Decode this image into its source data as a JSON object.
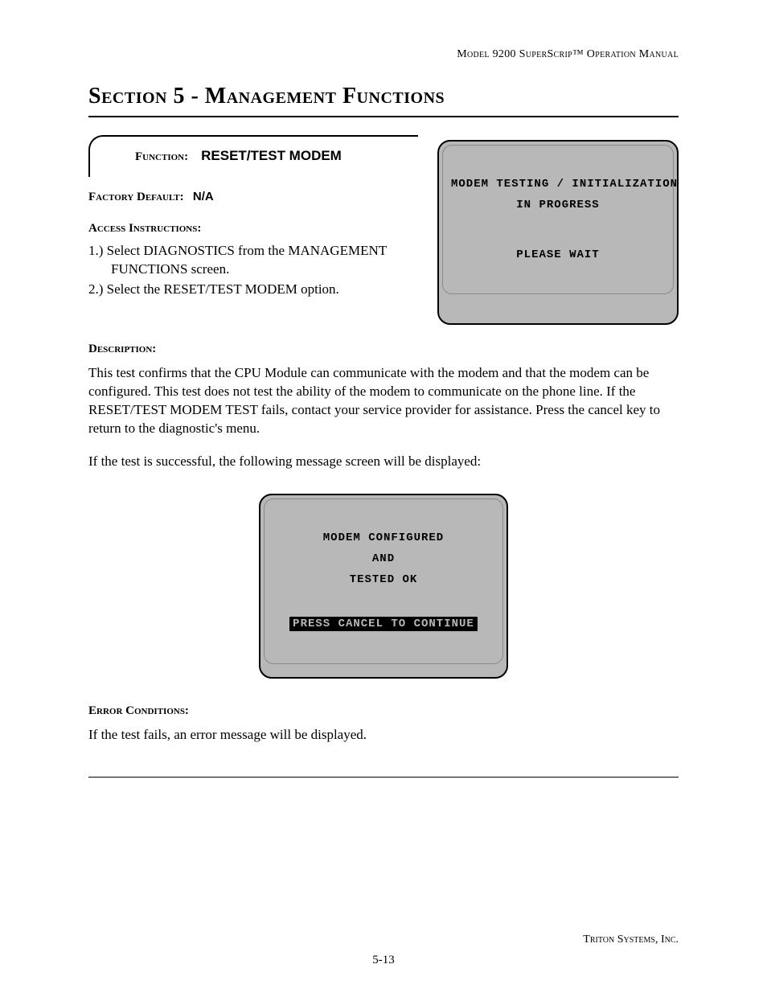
{
  "header": {
    "running_head": "Model 9200 SuperScrip™ Operation Manual"
  },
  "title": "Section 5 - Management Functions",
  "function_box": {
    "label": "Function:",
    "name": "RESET/TEST MODEM"
  },
  "factory_default": {
    "label": "Factory Default:",
    "value": "N/A"
  },
  "access": {
    "heading": "Access Instructions:",
    "steps": [
      "1.)  Select DIAGNOSTICS from the MANAGEMENT FUNCTIONS screen.",
      "2.)  Select the RESET/TEST MODEM option."
    ]
  },
  "description": {
    "heading": "Description:",
    "p1": "This test confirms that the CPU Module can communicate with the modem and that the modem can be configured.  This test does not test the ability of the modem to communicate on the phone line.  If the RESET/TEST MODEM TEST fails, contact your service provider for assistance.  Press the cancel key to return to the diagnostic's menu.",
    "p2": "If the test is successful, the following message screen will be displayed:"
  },
  "screens": {
    "progress": {
      "l1": "MODEM TESTING / INITIALIZATION",
      "l2": "IN PROGRESS",
      "l3": "PLEASE WAIT"
    },
    "success": {
      "l1": "MODEM CONFIGURED",
      "l2": "AND",
      "l3": "TESTED OK",
      "l4": "PRESS CANCEL TO CONTINUE"
    }
  },
  "error": {
    "heading": "Error Conditions:",
    "p1": "If the test fails, an error message will be displayed."
  },
  "footer": {
    "company": "Triton Systems, Inc.",
    "page_number": "5-13"
  }
}
